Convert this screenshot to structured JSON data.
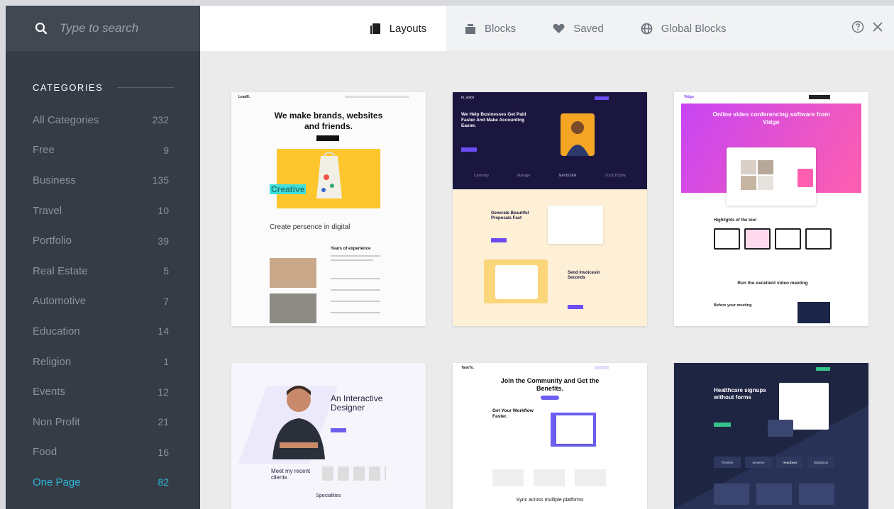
{
  "search": {
    "placeholder": "Type to search"
  },
  "sidebar": {
    "heading": "CATEGORIES",
    "categories": [
      {
        "name": "All Categories",
        "count": "232"
      },
      {
        "name": "Free",
        "count": "9"
      },
      {
        "name": "Business",
        "count": "135"
      },
      {
        "name": "Travel",
        "count": "10"
      },
      {
        "name": "Portfolio",
        "count": "39"
      },
      {
        "name": "Real Estate",
        "count": "5"
      },
      {
        "name": "Automotive",
        "count": "7"
      },
      {
        "name": "Education",
        "count": "14"
      },
      {
        "name": "Religion",
        "count": "1"
      },
      {
        "name": "Events",
        "count": "12"
      },
      {
        "name": "Non Profit",
        "count": "21"
      },
      {
        "name": "Food",
        "count": "16"
      },
      {
        "name": "One Page",
        "count": "82"
      }
    ],
    "active_index": 12
  },
  "tabs": {
    "layouts": "Layouts",
    "blocks": "Blocks",
    "saved": "Saved",
    "global": "Global Blocks"
  },
  "colors": {
    "accent": "#2fb8dd",
    "sidebar": "#353c45"
  },
  "cards": {
    "c1": {
      "logo": "Leadfl.",
      "headline": "We make brands, websites and friends.",
      "creative": "Creative",
      "sub": "Create persence in digital",
      "years": "Years of experience"
    },
    "c2": {
      "logo": "in_voice",
      "headline": "We Help Businesses Get Paid Faster And Make Accounting Easier.",
      "brands": [
        "Centrivity",
        "Manage",
        "NAVISTAR",
        "TOUCHSIDE"
      ],
      "f1": "Generate Beautiful Proposals Fast",
      "f2": "Send Invoicesin Seconds"
    },
    "c3": {
      "logo": "Vidgo",
      "headline": "Online video conferencing software from Vidgo",
      "highlights": "Highlights of the tool",
      "run": "Run the excellent video meeting",
      "before": "Before your meeting"
    },
    "c4": {
      "headline": "An Interactive Designer",
      "clients": "Meet my recent clients",
      "spec": "Specialities"
    },
    "c5": {
      "logo": "TaskTo.",
      "headline": "Join the Community and Get the Benefits.",
      "sub": "Get Your Workflow Faster.",
      "sync": "Sync across multiple platforms"
    },
    "c6": {
      "headline": "Healthcare signups without forms",
      "brands": [
        "Timeline",
        "universe",
        "Heartbeat",
        "Brightpool"
      ]
    }
  }
}
